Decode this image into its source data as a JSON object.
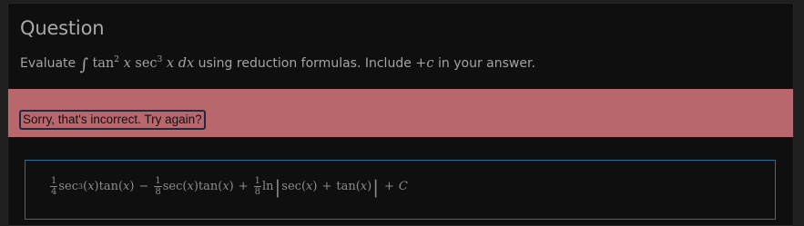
{
  "question": {
    "title": "Question",
    "prompt_prefix": "Evaluate",
    "integral_symbol": "∫",
    "prompt_middle": "using reduction formulas.  Include",
    "plus_c": "+c",
    "prompt_suffix": "in your answer."
  },
  "feedback": {
    "message": "Sorry, that's incorrect. Try again?"
  },
  "answer": {
    "term1_coef_num": "1",
    "term1_coef_den": "4",
    "term2_coef_num": "1",
    "term2_coef_den": "8",
    "term3_coef_num": "1",
    "term3_coef_den": "8",
    "minus": "−",
    "plus": "+",
    "constant": "C"
  },
  "colors": {
    "alert_background": "#b8676d",
    "answer_border": "#2c6d95",
    "card_background": "#0f0f0f"
  }
}
